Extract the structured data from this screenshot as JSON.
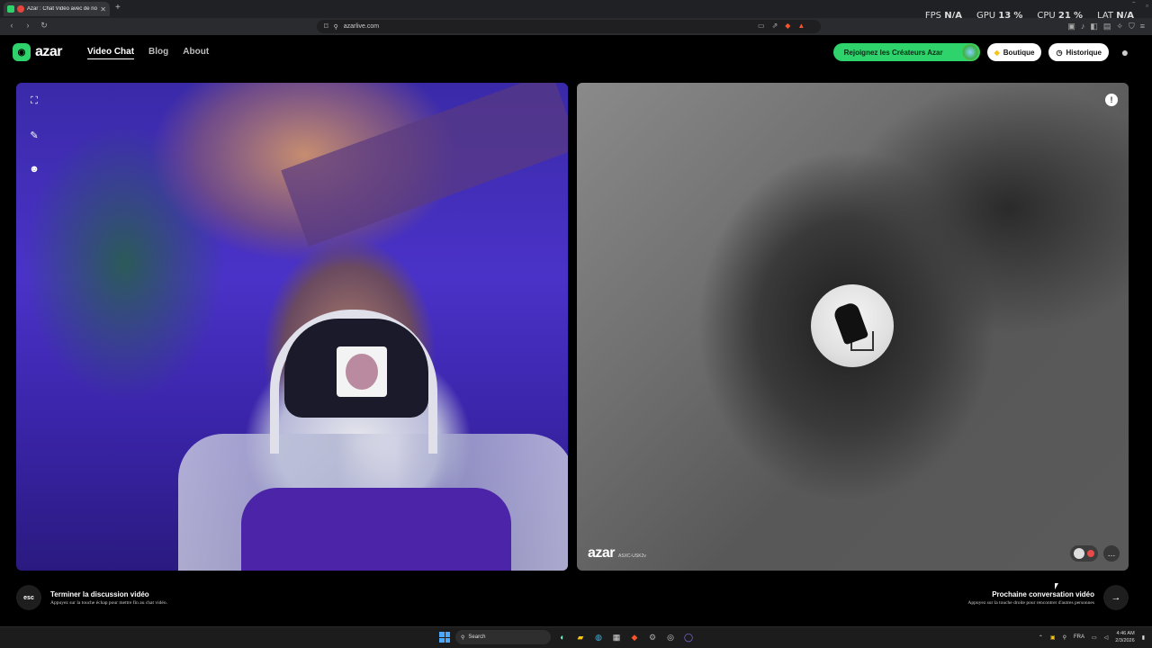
{
  "browser": {
    "tab_title": "Azar : Chat Vidéo avec de no",
    "url": "azarlive.com"
  },
  "hud": [
    {
      "label": "FPS",
      "value": "N/A"
    },
    {
      "label": "GPU",
      "value": "13",
      "unit": "%"
    },
    {
      "label": "CPU",
      "value": "21",
      "unit": "%"
    },
    {
      "label": "LAT",
      "value": "N/A"
    }
  ],
  "header": {
    "logo": "azar",
    "nav": [
      "Video Chat",
      "Blog",
      "About"
    ],
    "creators_button": "Rejoignez les Créateurs Azar",
    "shop_button": "Boutique",
    "history_button": "Historique"
  },
  "remote": {
    "watermark": "azar",
    "session_id": "ASXC-USK2v"
  },
  "footer": {
    "left_key": "esc",
    "left_title": "Terminer la discussion vidéo",
    "left_sub": "Appuyez sur la touche échap pour mettre fin au chat vidéo.",
    "right_title": "Prochaine conversation vidéo",
    "right_sub": "Appuyez sur la touche droite pour rencontrer d'autres personnes"
  },
  "taskbar": {
    "search": "Search",
    "lang": "FRA",
    "time": "4:46 AM",
    "date": "2/3/2026"
  },
  "colors": {
    "accent": "#2fd36b",
    "background": "#000000"
  },
  "icons": [
    "expand-icon",
    "magic-wand-icon",
    "face-filter-icon",
    "shield-icon",
    "chat-icon",
    "arrow-right-icon",
    "windows-icon",
    "search-icon"
  ]
}
